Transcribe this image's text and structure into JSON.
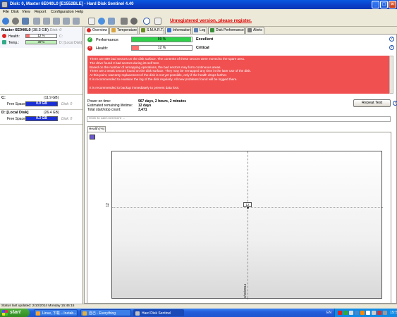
{
  "window": {
    "title": "Disk: 0, Maxtor 6E040L0 [E1552BLE]  -  Hard Disk Sentinel 4.40",
    "unregistered": "Unregistered version, please register."
  },
  "menu": [
    "File",
    "Disk",
    "View",
    "Report",
    "Configuration",
    "Help"
  ],
  "left_panel": {
    "disk": {
      "name": "Master 6E040L0",
      "size": "(38.3 GB)",
      "id": "Disk: 0",
      "health_label": "Health:",
      "health_value": "12 %",
      "health_level": 0.12,
      "health_drive": "C:",
      "temp_label": "Temp.:",
      "temp_value": "39°C",
      "temp_drive": "D: [Local Disk]"
    },
    "volumes": [
      {
        "name": "C:",
        "size": "(11.9 GB)",
        "free_label": "Free Space",
        "free_value": "0.0 GB",
        "free_level": 0.0,
        "disk": "Disk: 0"
      },
      {
        "name": "D: [Local Disk]",
        "size": "(26.4 GB)",
        "free_label": "Free Space",
        "free_value": "0.3 GB",
        "free_level": 0.011,
        "disk": "Disk: 0"
      }
    ]
  },
  "tabs": [
    "Overview",
    "Temperature",
    "S.M.A.R.T.",
    "Information",
    "Log",
    "Disk Performance",
    "Alerts"
  ],
  "overview": {
    "performance_label": "Performance:",
    "performance_value": "99 %",
    "performance_level": 0.99,
    "performance_verdict": "Excellent",
    "health_label": "Health:",
    "health_value": "12 %",
    "health_level": 0.12,
    "health_verdict": "Critical",
    "description": [
      "There are 899 bad sectors on the disk surface. The contents of these sectors were moved to the spare area.",
      "The drive found 2 bad sectors during its self test.",
      "Based on the number of remapping operations, the bad sectors may form continuous areas.",
      "There are 2 weak sectors found on the disk surface. They may be remapped any time in the later use of the disk.",
      "At this point, warranty replacement of the disk is not yet possible, only if the health drops further.",
      "It is recommended to examine the log of the disk regularly. All new problems found will be logged there.",
      "",
      "It is recommended to backup immediately to prevent data loss."
    ],
    "power_on_label": "Power on time:",
    "power_on_value": "967 days, 2 hours, 2 minutes",
    "lifetime_label": "Estimated remaining lifetime:",
    "lifetime_value": "12 days",
    "startstop_label": "Total start/stop count:",
    "startstop_value": "3,471",
    "repeat_test": "Repeat Test",
    "comment_placeholder": "Click to add comment ...",
    "graph_tab": "Health [%]"
  },
  "chart_data": {
    "type": "line",
    "title": "",
    "xlabel": "",
    "ylabel": "",
    "x": [
      "2/10/2014"
    ],
    "series": [
      {
        "values": [
          12
        ]
      }
    ],
    "ytick_labels": [
      "12"
    ],
    "data_labels": [
      "12"
    ],
    "grid": true
  },
  "status": {
    "text": "Status last updated: 2/10/2014 Monday 15:46:15"
  },
  "taskbar": {
    "start": "start",
    "tasks": [
      "Linux, 下载 – Inetab...",
      "自己 - Everything",
      "Hard Disk Sentinel"
    ],
    "lang": "EN",
    "clock": "15:50"
  },
  "colors": {
    "critical": "#f15050",
    "performance_fill": "#2fd04a",
    "health_fill": "#ff7070",
    "free_space": "#1a2ed8",
    "title_bar": "#0a58e0"
  }
}
